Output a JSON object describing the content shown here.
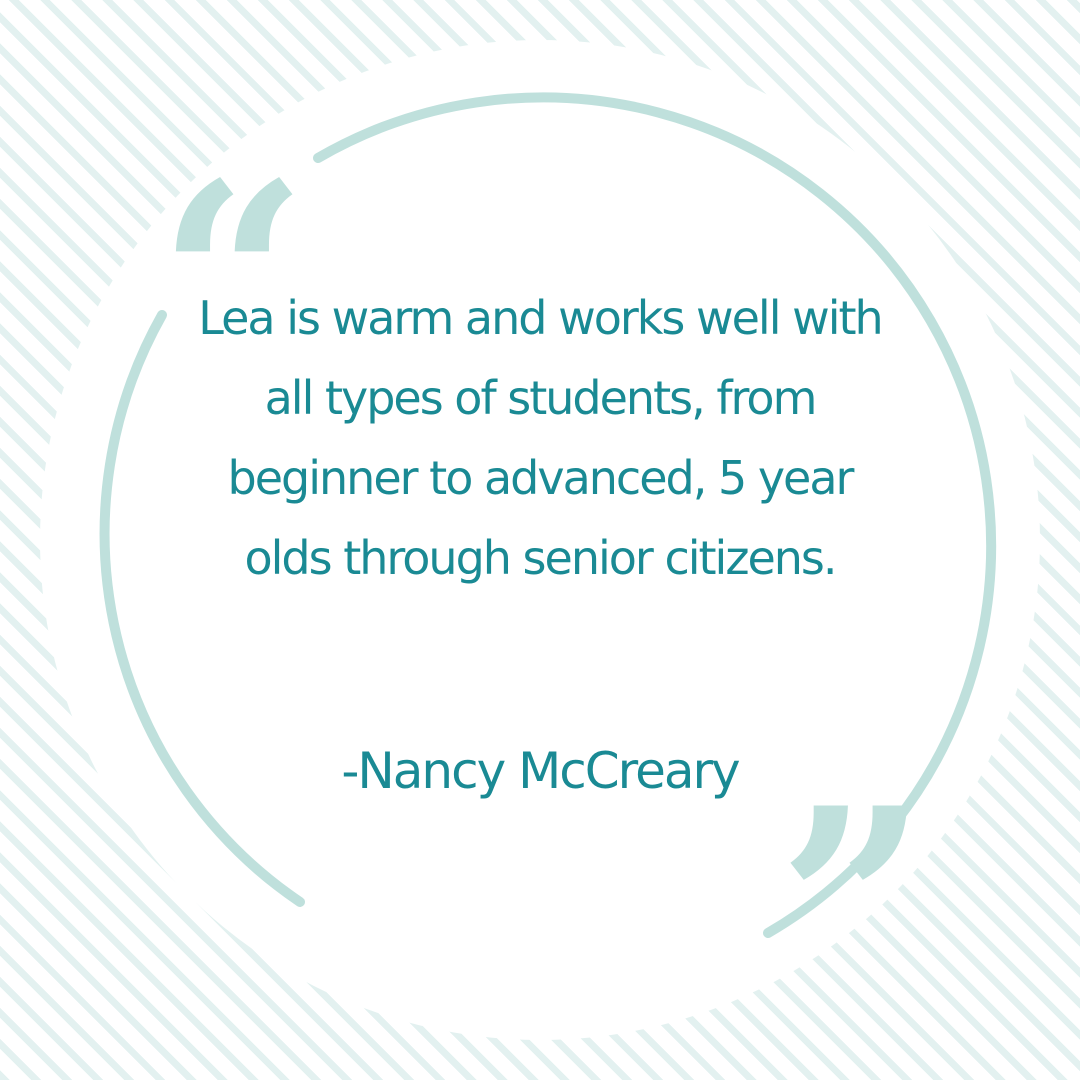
{
  "quote": {
    "text": "Lea is warm and works well with all types of students, from beginner to advanced, 5 year olds through senior citizens.",
    "author": "-Nancy McCreary",
    "open_mark": "“",
    "close_mark": "”"
  },
  "colors": {
    "text": "#1a8a94",
    "accent": "#bfe0dc",
    "stripes": "#e3f1f0",
    "background": "#ffffff"
  }
}
